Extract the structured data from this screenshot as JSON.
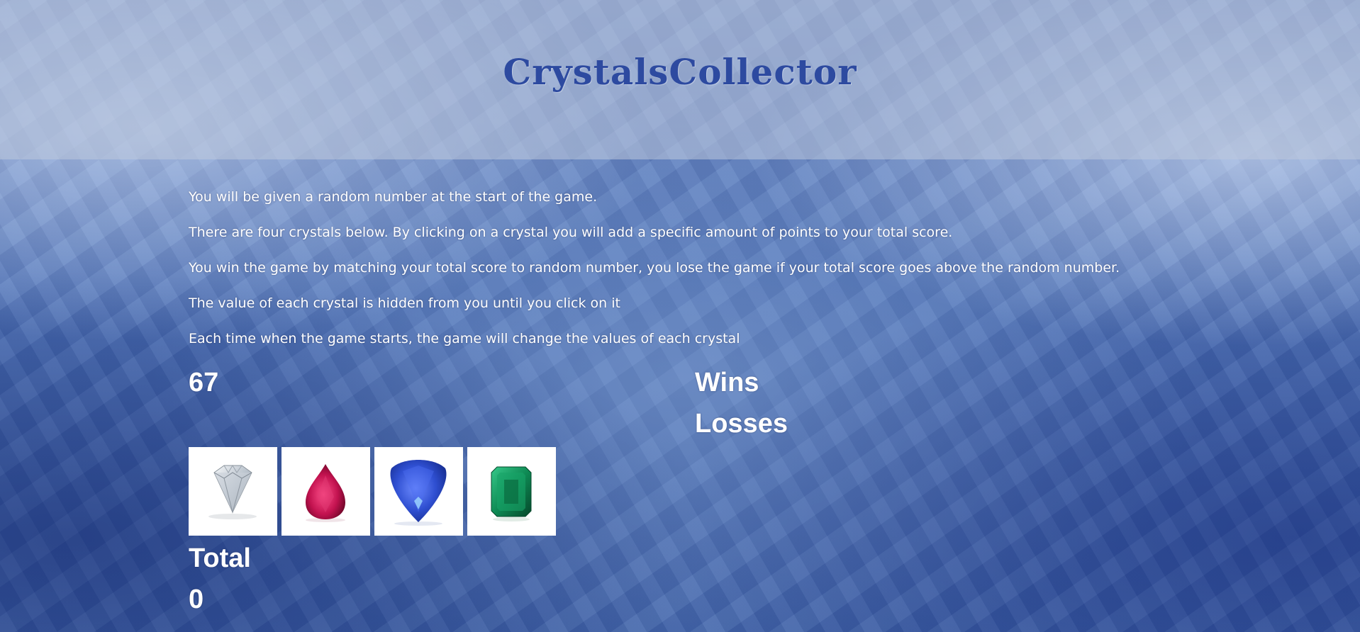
{
  "header": {
    "title": "CrystalsCollector"
  },
  "instructions": [
    "You will be given a random number at the start of the game.",
    "There are four crystals below. By clicking on a crystal you will add a specific amount of points to your total score.",
    "You win the game by matching your total score to random number, you lose the game if your total score goes above the random number.",
    "The value of each crystal is hidden from you until you click on it",
    "Each time when the game starts, the game will change the values of each crystal"
  ],
  "game": {
    "random_number": "67",
    "wins_label": "Wins",
    "losses_label": "Losses",
    "total_label": "Total",
    "total_value": "0"
  },
  "crystals": [
    {
      "name": "diamond-icon",
      "color": "#cfd6de"
    },
    {
      "name": "ruby-icon",
      "color": "#c2124f"
    },
    {
      "name": "sapphire-icon",
      "color": "#2f4fd1"
    },
    {
      "name": "emerald-icon",
      "color": "#0e8a54"
    }
  ]
}
